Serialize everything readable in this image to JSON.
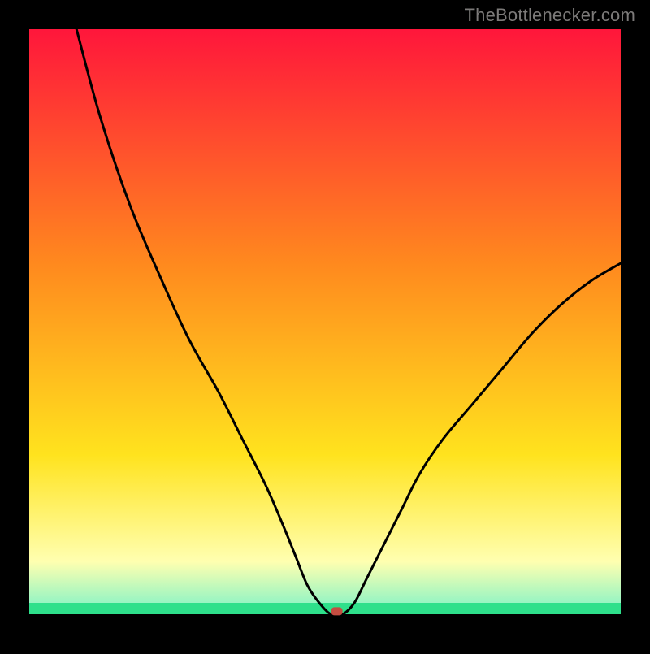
{
  "watermark": "TheBottlenecker.com",
  "chart_data": {
    "type": "line",
    "title": "",
    "xlabel": "",
    "ylabel": "",
    "xlim": [
      0,
      100
    ],
    "ylim": [
      0,
      100
    ],
    "background_gradient": {
      "top": "#ff163b",
      "mid1": "#ff8a1e",
      "mid2": "#ffe31e",
      "low": "#ffffb0",
      "bottom_band": "#2ee08b",
      "bottom_axis": "#000000"
    },
    "series": [
      {
        "name": "curve",
        "x_pct": [
          8,
          12,
          17,
          22,
          27,
          32,
          36,
          40,
          43,
          45,
          47,
          49,
          51,
          53,
          55,
          57,
          60,
          63,
          66,
          70,
          75,
          80,
          85,
          90,
          95,
          100
        ],
        "y_pct": [
          100,
          85,
          70,
          58,
          47,
          38,
          30,
          22,
          15,
          10,
          5,
          2,
          0,
          0,
          2,
          6,
          12,
          18,
          24,
          30,
          36,
          42,
          48,
          53,
          57,
          60
        ]
      }
    ],
    "marker": {
      "x_pct": 52,
      "y_pct": 0.5,
      "color": "#c44d41"
    }
  }
}
